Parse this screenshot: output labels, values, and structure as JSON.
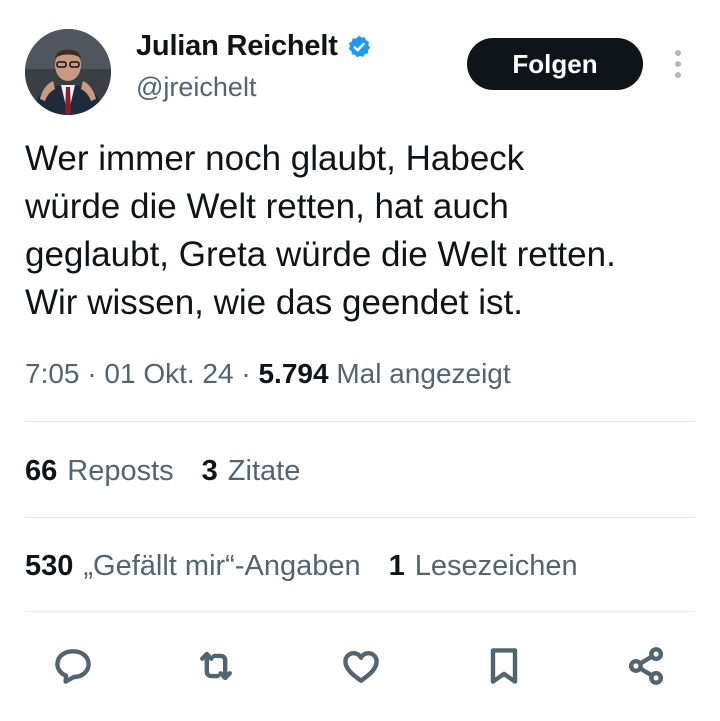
{
  "author": {
    "name": "Julian Reichelt",
    "handle": "@jreichelt",
    "verified_icon": "verified-badge-icon",
    "accent_color": "#1d9bf0"
  },
  "follow_button": {
    "label": "Folgen"
  },
  "more_menu_icon": "more-vertical-icon",
  "tweet": {
    "lines": [
      "Wer immer noch glaubt, Habeck",
      "würde die Welt retten, hat auch",
      "geglaubt, Greta würde die Welt retten.",
      "Wir wissen, wie das geendet ist."
    ]
  },
  "meta": {
    "time": "7:05",
    "separator": " · ",
    "date": "01 Okt. 24",
    "views_count": "5.794",
    "views_label": "Mal angezeigt"
  },
  "stats": {
    "reposts": {
      "count": "66",
      "label": "Reposts"
    },
    "quotes": {
      "count": "3",
      "label": "Zitate"
    },
    "likes": {
      "count": "530",
      "label": "„Gefällt mir“-Angaben"
    },
    "bookmarks": {
      "count": "1",
      "label": "Lesezeichen"
    }
  },
  "actions": [
    {
      "name": "reply-icon"
    },
    {
      "name": "repost-icon"
    },
    {
      "name": "like-icon"
    },
    {
      "name": "bookmark-icon"
    },
    {
      "name": "share-icon"
    }
  ],
  "colors": {
    "text_primary": "#0f1419",
    "text_secondary": "#536471",
    "divider": "#e3e7ea",
    "button_bg": "#0f1419"
  }
}
